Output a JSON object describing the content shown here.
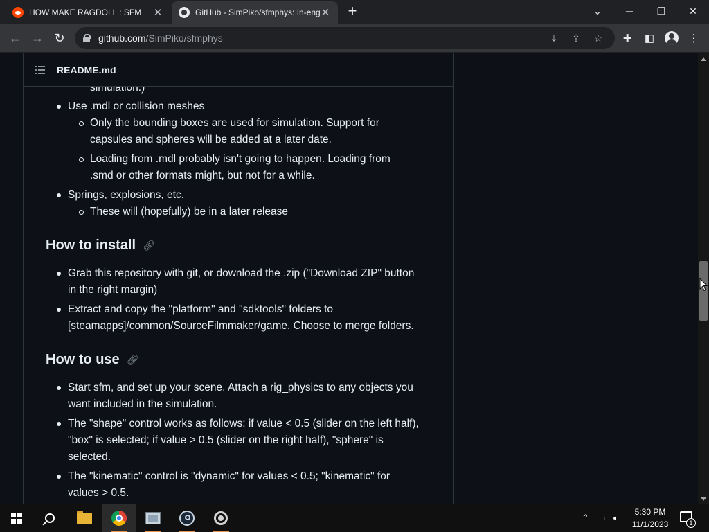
{
  "browser": {
    "tabs": [
      {
        "title": "HOW MAKE RAGDOLL : SFM",
        "icon": "reddit-icon",
        "active": false
      },
      {
        "title": "GitHub - SimPiko/sfmphys: In-eng",
        "icon": "github-icon",
        "active": true
      }
    ],
    "new_tab_label": "+",
    "url_host": "github.com",
    "url_path": "/SimPiko/sfmphys"
  },
  "readme": {
    "header_title": "README.md",
    "partial_line": "simulation.)",
    "list1": [
      {
        "text": "Use .mdl or collision meshes"
      },
      {
        "text": "Only the bounding boxes are used for simulation. Support for"
      },
      {
        "text": "capsules and spheres will be added at a later date."
      },
      {
        "text": "Loading from .mdl probably isn't going to happen. Loading from"
      },
      {
        "text": ".smd or other formats might, but not for a while."
      },
      {
        "text": "Springs, explosions, etc."
      },
      {
        "text": "These will (hopefully) be in a later release"
      }
    ],
    "install": {
      "heading": "How to install",
      "lines": [
        "Grab this repository with git, or download the .zip (\"Download ZIP\" button",
        "in the right margin)",
        "Extract and copy the \"platform\" and \"sdktools\" folders to",
        "[steamapps]/common/SourceFilmmaker/game. Choose to merge folders."
      ]
    },
    "use": {
      "heading": "How to use",
      "lines": [
        "Start sfm, and set up your scene. Attach a rig_physics to any objects you",
        "want included in the simulation.",
        "The \"shape\" control works as follows: if value < 0.5 (slider on the left half),",
        "\"box\" is selected; if value > 0.5 (slider on the right half), \"sphere\" is",
        "selected.",
        "The \"kinematic\" control is \"dynamic\" for values < 0.5; \"kinematic\" for",
        "values > 0.5."
      ]
    }
  },
  "taskbar": {
    "time": "5:30 PM",
    "date": "11/1/2023",
    "notification_count": "1"
  },
  "colors": {
    "page_bg": "#0d1117",
    "text": "#e6edf3",
    "muted": "#8b949e",
    "border": "#30363d",
    "chrome_tab": "#35363a",
    "chrome_strip": "#202124"
  }
}
